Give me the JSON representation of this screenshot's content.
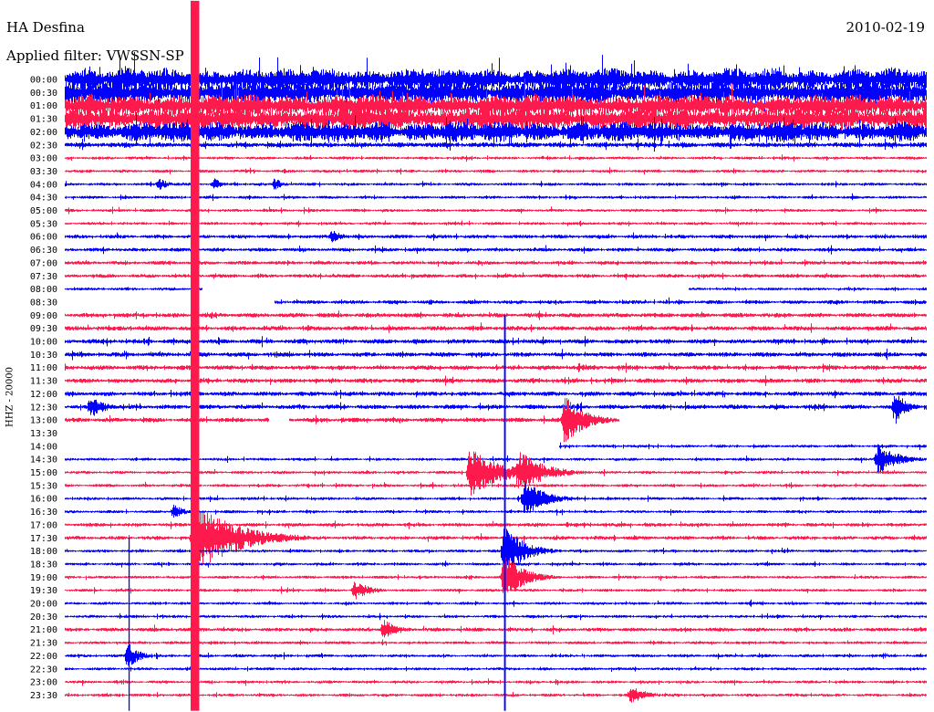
{
  "header": {
    "station": "HA Desfina",
    "filter_label": "Applied filter:",
    "filter_value": "VWSSN-SP",
    "date": "2010-02-19"
  },
  "chart_data": {
    "type": "line",
    "title": "HA Desfina",
    "ylabel": "HHZ - 20000",
    "date": "2010-02-19",
    "x_range_minutes": [
      0,
      30
    ],
    "row_interval_minutes": 30,
    "row_labels": [
      "00:00",
      "00:30",
      "01:00",
      "01:30",
      "02:00",
      "02:30",
      "03:00",
      "03:30",
      "04:00",
      "04:30",
      "05:00",
      "05:30",
      "06:00",
      "06:30",
      "07:00",
      "07:30",
      "08:00",
      "08:30",
      "09:00",
      "09:30",
      "10:00",
      "10:30",
      "11:00",
      "11:30",
      "12:00",
      "12:30",
      "13:00",
      "13:30",
      "14:00",
      "14:30",
      "15:00",
      "15:30",
      "16:00",
      "16:30",
      "17:00",
      "17:30",
      "18:00",
      "18:30",
      "19:00",
      "19:30",
      "20:00",
      "20:30",
      "21:00",
      "21:30",
      "22:00",
      "22:30",
      "23:00",
      "23:30"
    ],
    "colors": {
      "odd_hour_trace": "#ff1a4d",
      "even_hour_trace": "#0000ff"
    },
    "noise_level_per_row": [
      0.95,
      0.95,
      0.95,
      0.95,
      0.85,
      0.2,
      0.12,
      0.12,
      0.12,
      0.12,
      0.12,
      0.12,
      0.15,
      0.15,
      0.15,
      0.15,
      0.12,
      0.15,
      0.18,
      0.18,
      0.18,
      0.18,
      0.18,
      0.18,
      0.18,
      0.18,
      0.18,
      0.0,
      0.12,
      0.12,
      0.12,
      0.12,
      0.12,
      0.12,
      0.15,
      0.15,
      0.12,
      0.12,
      0.12,
      0.12,
      0.12,
      0.12,
      0.15,
      0.12,
      0.12,
      0.12,
      0.12,
      0.12
    ],
    "data_gaps": [
      {
        "row": "08:00",
        "from_minute": 4.8,
        "to_minute": 21.7
      },
      {
        "row": "08:30",
        "from_minute": 0.0,
        "to_minute": 7.3
      },
      {
        "row": "13:00",
        "from_minute": 7.1,
        "to_minute": 7.8
      },
      {
        "row": "13:00",
        "from_minute": 19.3,
        "to_minute": 30.0
      },
      {
        "row": "13:30",
        "from_minute": 0.0,
        "to_minute": 30.0
      },
      {
        "row": "14:00",
        "from_minute": 0.0,
        "to_minute": 17.2
      }
    ],
    "events": [
      {
        "row": "04:00",
        "minute": 3.3,
        "amplitude": 0.55,
        "duration_minutes": 0.8
      },
      {
        "row": "04:00",
        "minute": 5.2,
        "amplitude": 0.5,
        "duration_minutes": 0.8
      },
      {
        "row": "04:00",
        "minute": 7.3,
        "amplitude": 0.55,
        "duration_minutes": 0.8
      },
      {
        "row": "06:00",
        "minute": 9.3,
        "amplitude": 0.6,
        "duration_minutes": 1.0
      },
      {
        "row": "12:30",
        "minute": 0.9,
        "amplitude": 0.9,
        "duration_minutes": 1.5
      },
      {
        "row": "13:00",
        "minute": 17.4,
        "amplitude": 2.0,
        "duration_minutes": 2.0
      },
      {
        "row": "12:30",
        "minute": 28.9,
        "amplitude": 1.5,
        "duration_minutes": 1.0
      },
      {
        "row": "14:30",
        "minute": 28.3,
        "amplitude": 1.2,
        "duration_minutes": 2.0
      },
      {
        "row": "15:00",
        "minute": 14.1,
        "amplitude": 2.0,
        "duration_minutes": 3.0
      },
      {
        "row": "15:00",
        "minute": 15.8,
        "amplitude": 1.8,
        "duration_minutes": 2.5
      },
      {
        "row": "16:00",
        "minute": 16.0,
        "amplitude": 1.5,
        "duration_minutes": 2.0
      },
      {
        "row": "16:30",
        "minute": 3.8,
        "amplitude": 0.6,
        "duration_minutes": 1.0
      },
      {
        "row": "17:30",
        "minute": 4.5,
        "amplitude": 3.0,
        "duration_minutes": 4.0
      },
      {
        "row": "18:00",
        "minute": 15.3,
        "amplitude": 2.0,
        "duration_minutes": 2.0
      },
      {
        "row": "19:00",
        "minute": 15.3,
        "amplitude": 1.8,
        "duration_minutes": 2.0
      },
      {
        "row": "19:30",
        "minute": 10.1,
        "amplitude": 0.8,
        "duration_minutes": 1.5
      },
      {
        "row": "21:00",
        "minute": 11.1,
        "amplitude": 0.8,
        "duration_minutes": 1.5
      },
      {
        "row": "22:00",
        "minute": 2.2,
        "amplitude": 1.2,
        "duration_minutes": 1.0
      },
      {
        "row": "23:30",
        "minute": 19.7,
        "amplitude": 0.8,
        "duration_minutes": 1.5
      }
    ],
    "spikes": [
      {
        "minute": 4.53,
        "color": "#ff1a4d",
        "width_minutes": 0.3,
        "from_row": "00:00",
        "to_row": "23:30"
      },
      {
        "minute": 2.24,
        "color": "#0000ff",
        "width_minutes": 0.04,
        "from_row": "20:30",
        "to_row": "23:30"
      },
      {
        "minute": 15.32,
        "color": "#0000ff",
        "width_minutes": 0.06,
        "from_row": "12:00",
        "to_row": "23:30"
      }
    ]
  }
}
